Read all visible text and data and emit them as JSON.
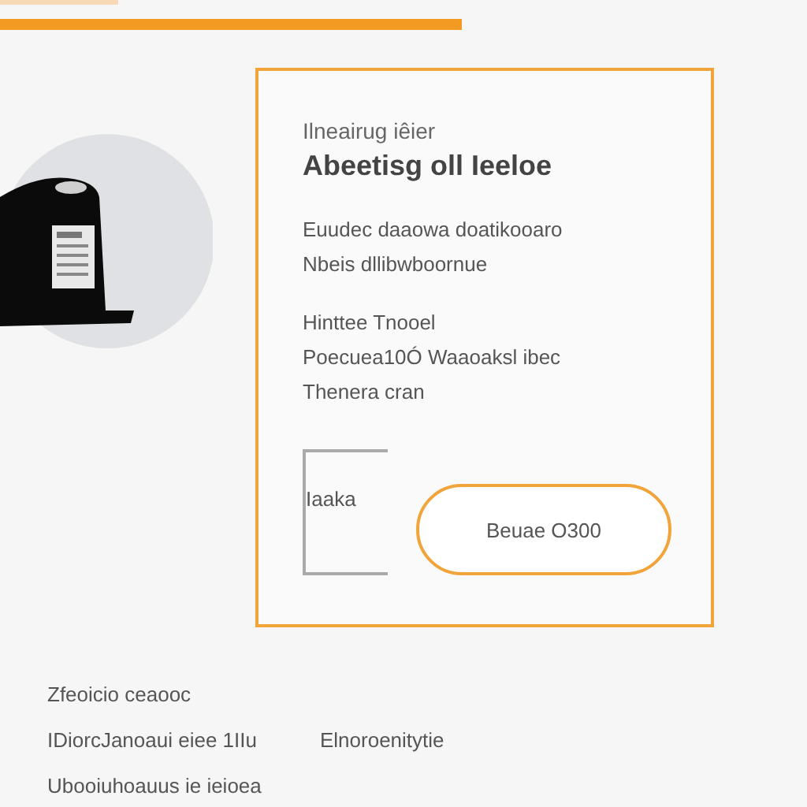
{
  "card": {
    "subtitle": "Ilneairug iêier",
    "title": "Abeetisg oll Ieeloe",
    "paragraphs": [
      [
        "Euudec daaowa doatikooaro",
        "Nbeis  dllibwboornue"
      ],
      [
        "Hinttee Tnooel",
        "Poecuea10Ó  Waaoaksl ibec",
        "Thenera cran"
      ]
    ],
    "field": {
      "value": "Iaaka"
    },
    "button": "Beuae O300"
  },
  "footer": [
    [
      "Zfeoicio ceaooc"
    ],
    [
      "IDiorcJanoaui eiee 1IIu",
      "Elnoroenitytie"
    ],
    [
      "Ubooiuhoauus ie ieioea"
    ]
  ]
}
